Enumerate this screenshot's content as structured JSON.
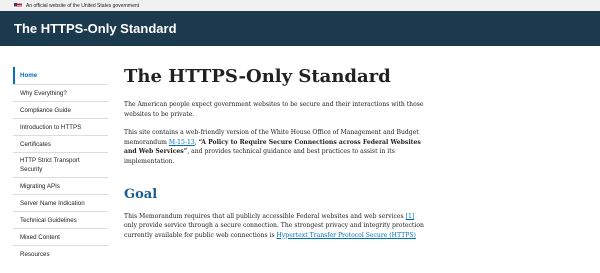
{
  "banner": {
    "flag_icon": "us-flag-icon",
    "text": "An official website of the United States government"
  },
  "header": {
    "title": "The HTTPS-Only Standard"
  },
  "sidebar": {
    "items": [
      {
        "label": "Home",
        "active": true
      },
      {
        "label": "Why Everything?"
      },
      {
        "label": "Compliance Guide"
      },
      {
        "label": "Introduction to HTTPS"
      },
      {
        "label": "Certificates"
      },
      {
        "label": "HTTP Strict Transport Security"
      },
      {
        "label": "Migrating APIs"
      },
      {
        "label": "Server Name Indication"
      },
      {
        "label": "Technical Guidelines"
      },
      {
        "label": "Mixed Content"
      },
      {
        "label": "Resources"
      }
    ]
  },
  "main": {
    "title": "The HTTPS-Only Standard",
    "intro": "The American people expect government websites to be secure and their interactions with those websites to be private.",
    "p2_start": "This site contains a web-friendly version of the White House Office of Management and Budget memorandum ",
    "p2_link": "M-15-13",
    "p2_mid": ", ",
    "p2_strong": "“A Policy to Require Secure Connections across Federal Websites and Web Services”",
    "p2_end": ", and provides technical guidance and best practices to assist in its implementation.",
    "goal_heading": "Goal",
    "goal_start": "This Memorandum requires that all publicly accessible Federal websites and web services ",
    "goal_ref": "[1]",
    "goal_mid": " only provide service through a secure connection. The strongest privacy and integrity protection currently available for public web connections is ",
    "goal_link": "Hypertext Transfer Protocol Secure (HTTPS)"
  },
  "colors": {
    "header_bg": "#1b3a4e",
    "link": "#0071bb",
    "goal_heading": "#1b5c8e"
  }
}
